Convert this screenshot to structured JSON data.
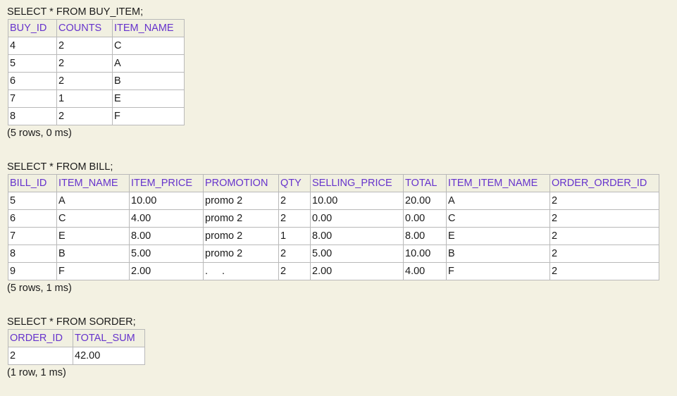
{
  "queries": [
    {
      "sql": "SELECT * FROM BUY_ITEM;",
      "columns": [
        "BUY_ID",
        "COUNTS",
        "ITEM_NAME"
      ],
      "rows": [
        [
          "4",
          "2",
          "C"
        ],
        [
          "5",
          "2",
          "A"
        ],
        [
          "6",
          "2",
          "B"
        ],
        [
          "7",
          "1",
          "E"
        ],
        [
          "8",
          "2",
          "F"
        ]
      ],
      "stats": "(5 rows, 0 ms)"
    },
    {
      "sql": "SELECT * FROM BILL;",
      "columns": [
        "BILL_ID",
        "ITEM_NAME",
        "ITEM_PRICE",
        "PROMOTION",
        "QTY",
        "SELLING_PRICE",
        "TOTAL",
        "ITEM_ITEM_NAME",
        "ORDER_ORDER_ID"
      ],
      "rows": [
        [
          "5",
          "A",
          "10.00",
          "promo 2",
          "2",
          "10.00",
          "20.00",
          "A",
          "2"
        ],
        [
          "6",
          "C",
          "4.00",
          "promo 2",
          "2",
          "0.00",
          "0.00",
          "C",
          "2"
        ],
        [
          "7",
          "E",
          "8.00",
          "promo 2",
          "1",
          "8.00",
          "8.00",
          "E",
          "2"
        ],
        [
          "8",
          "B",
          "5.00",
          "promo 2",
          "2",
          "5.00",
          "10.00",
          "B",
          "2"
        ],
        [
          "9",
          "F",
          "2.00",
          ". .",
          "2",
          "2.00",
          "4.00",
          "F",
          "2"
        ]
      ],
      "stats": "(5 rows, 1 ms)"
    },
    {
      "sql": "SELECT * FROM SORDER;",
      "columns": [
        "ORDER_ID",
        "TOTAL_SUM"
      ],
      "rows": [
        [
          "2",
          "42.00"
        ]
      ],
      "stats": "(1 row, 1 ms)"
    }
  ]
}
